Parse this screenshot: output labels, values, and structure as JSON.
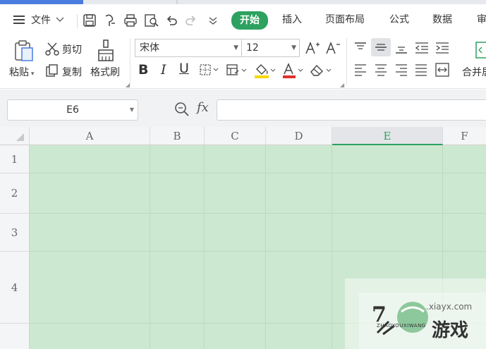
{
  "menubar": {
    "file_label": "文件",
    "tabs": [
      {
        "label": "开始",
        "active": true
      },
      {
        "label": "插入"
      },
      {
        "label": "页面布局"
      },
      {
        "label": "公式"
      },
      {
        "label": "数据"
      },
      {
        "label": "审"
      }
    ]
  },
  "ribbon": {
    "paste_label": "粘贴",
    "cut_label": "剪切",
    "copy_label": "复制",
    "format_painter_label": "格式刷",
    "font_name": "宋体",
    "font_size": "12",
    "merge_label": "合并居"
  },
  "formula_bar": {
    "name_box": "E6",
    "fx_label": "fx",
    "formula": ""
  },
  "sheet": {
    "columns": [
      "A",
      "B",
      "C",
      "D",
      "E",
      "F"
    ],
    "selected_column": "E",
    "rows": [
      "1",
      "2",
      "3",
      "4"
    ],
    "fill_color": "#cde8d0"
  },
  "accent_color": "#2da160",
  "watermark": {
    "site": ".xiayx.com",
    "brand": "游戏",
    "pinyin": "ZHAOYOUXIWANG"
  }
}
